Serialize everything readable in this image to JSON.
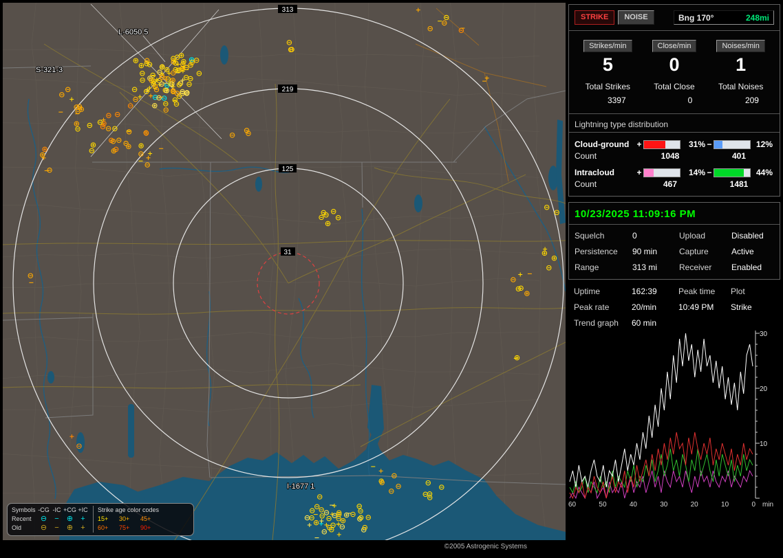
{
  "window": {
    "copyright": "©2005 Astrogenic Systems"
  },
  "map": {
    "ring_labels": [
      "313",
      "219",
      "125",
      "31"
    ],
    "storm_labels": [
      "L-6050  5",
      "S-321-3",
      "I-1677 1"
    ],
    "colors": {
      "recent_strike": "#00e0e6",
      "land": "#57504a",
      "water": "#1b5876",
      "ring": "#ececec",
      "range_ring_red": "#e04040"
    },
    "strike_clusters": [
      {
        "cx": 232,
        "cy": 118,
        "rx": 52,
        "ry": 40,
        "count": 78,
        "palette": [
          "#ffd800",
          "#ffd800",
          "#ffe34d",
          "#ffaa00"
        ],
        "cyan": 3
      },
      {
        "cx": 262,
        "cy": 86,
        "rx": 30,
        "ry": 22,
        "count": 18,
        "palette": [
          "#ffd800",
          "#ffcc00"
        ],
        "cyan": 1
      },
      {
        "cx": 158,
        "cy": 188,
        "rx": 58,
        "ry": 48,
        "count": 24,
        "palette": [
          "#ffd800",
          "#ffaa00",
          "#ff8800"
        ],
        "cyan": 0
      },
      {
        "cx": 108,
        "cy": 152,
        "rx": 38,
        "ry": 32,
        "count": 12,
        "palette": [
          "#ffaa00",
          "#ffd800"
        ],
        "cyan": 0
      },
      {
        "cx": 205,
        "cy": 225,
        "rx": 30,
        "ry": 20,
        "count": 6,
        "palette": [
          "#ffaa00",
          "#ffd800"
        ],
        "cyan": 0
      },
      {
        "cx": 60,
        "cy": 235,
        "rx": 26,
        "ry": 38,
        "count": 5,
        "palette": [
          "#ffaa00",
          "#ff8800"
        ],
        "cyan": 0
      },
      {
        "cx": 480,
        "cy": 748,
        "rx": 58,
        "ry": 34,
        "count": 42,
        "palette": [
          "#ffd800",
          "#ffe34d",
          "#ffcc00"
        ],
        "cyan": 1
      },
      {
        "cx": 560,
        "cy": 692,
        "rx": 30,
        "ry": 22,
        "count": 7,
        "palette": [
          "#ffd800",
          "#ffaa00"
        ],
        "cyan": 0
      },
      {
        "cx": 622,
        "cy": 716,
        "rx": 30,
        "ry": 25,
        "count": 5,
        "palette": [
          "#ffd800"
        ],
        "cyan": 0
      },
      {
        "cx": 470,
        "cy": 312,
        "rx": 22,
        "ry": 18,
        "count": 6,
        "palette": [
          "#ffd800"
        ],
        "cyan": 0
      },
      {
        "cx": 752,
        "cy": 402,
        "rx": 16,
        "ry": 30,
        "count": 6,
        "palette": [
          "#ffd800",
          "#ffaa00"
        ],
        "cyan": 0
      },
      {
        "cx": 796,
        "cy": 372,
        "rx": 12,
        "ry": 26,
        "count": 4,
        "palette": [
          "#ffd800"
        ],
        "cyan": 0
      },
      {
        "cx": 800,
        "cy": 300,
        "rx": 10,
        "ry": 14,
        "count": 2,
        "palette": [
          "#ffd800"
        ],
        "cyan": 0
      },
      {
        "cx": 748,
        "cy": 522,
        "rx": 10,
        "ry": 10,
        "count": 2,
        "palette": [
          "#ffd800"
        ],
        "cyan": 0
      },
      {
        "cx": 640,
        "cy": 30,
        "rx": 48,
        "ry": 22,
        "count": 7,
        "palette": [
          "#ffaa00",
          "#ff8800",
          "#ffd800"
        ],
        "cyan": 0
      },
      {
        "cx": 702,
        "cy": 116,
        "rx": 8,
        "ry": 8,
        "count": 2,
        "palette": [
          "#ffaa00"
        ],
        "cyan": 0
      },
      {
        "cx": 345,
        "cy": 185,
        "rx": 25,
        "ry": 15,
        "count": 3,
        "palette": [
          "#ffaa00"
        ],
        "cyan": 0
      },
      {
        "cx": 418,
        "cy": 62,
        "rx": 15,
        "ry": 12,
        "count": 3,
        "palette": [
          "#ffcc00"
        ],
        "cyan": 0
      },
      {
        "cx": 45,
        "cy": 420,
        "rx": 12,
        "ry": 30,
        "count": 2,
        "palette": [
          "#ffaa00"
        ],
        "cyan": 0
      },
      {
        "cx": 108,
        "cy": 640,
        "rx": 15,
        "ry": 15,
        "count": 2,
        "palette": [
          "#ff8800"
        ],
        "cyan": 0
      }
    ],
    "legend": {
      "symbols_label": "Symbols",
      "headers": [
        "-CG",
        "-IC",
        "+CG",
        "+IC"
      ],
      "recent_label": "Recent",
      "old_label": "Old",
      "glyphs": {
        "cg_minus": "⊖",
        "ic_minus": "−",
        "cg_plus": "⊕",
        "ic_plus": "+"
      },
      "age_title": "Strike age color codes",
      "age_recent": [
        "15+",
        "30+",
        "45+"
      ],
      "age_old": [
        "60+",
        "75+",
        "90+"
      ]
    }
  },
  "panel": {
    "strike_button": "STRIKE",
    "noise_button": "NOISE",
    "bearing_label": "Bng 170°",
    "bearing_value": "248mi",
    "rate_badges": [
      "Strikes/min",
      "Close/min",
      "Noises/min"
    ],
    "rates": [
      "5",
      "0",
      "1"
    ],
    "total_labels": [
      "Total Strikes",
      "Total Close",
      "Total Noises"
    ],
    "total_values": [
      "3397",
      "0",
      "209"
    ],
    "distribution": {
      "title": "Lightning type distribution",
      "count_label": "Count",
      "plus_sign": "+",
      "minus_sign": "−",
      "cloud_ground": {
        "label": "Cloud-ground",
        "plus_pct": "31%",
        "plus_pct_num": 31,
        "plus_color": "#ff1414",
        "plus_count": "1048",
        "minus_pct": "12%",
        "minus_pct_num": 12,
        "minus_color": "#5a9cf8",
        "minus_count": "401"
      },
      "intracloud": {
        "label": "Intracloud",
        "plus_pct": "14%",
        "plus_pct_num": 14,
        "plus_color": "#ff80cc",
        "plus_count": "467",
        "minus_pct": "44%",
        "minus_pct_num": 44,
        "minus_color": "#00d828",
        "minus_count": "1481"
      }
    },
    "status": {
      "datetime": "10/23/2025 11:09:16 PM",
      "squelch_label": "Squelch",
      "squelch": "0",
      "persistence_label": "Persistence",
      "persistence": "90 min",
      "range_label": "Range",
      "range": "313 mi",
      "upload_label": "Upload",
      "upload": "Disabled",
      "capture_label": "Capture",
      "capture": "Active",
      "receiver_label": "Receiver",
      "receiver": "Enabled"
    },
    "info": {
      "uptime_label": "Uptime",
      "uptime": "162:39",
      "peak_time_label": "Peak time",
      "plot_label": "Plot",
      "peak_rate_label": "Peak rate",
      "peak_rate": "20/min",
      "peak_time": "10:49 PM",
      "plot_value": "Strike",
      "trend_label": "Trend graph",
      "trend_window": "60 min"
    }
  },
  "chart_data": {
    "type": "line",
    "title": "Trend graph (strikes per minute, last 60 min)",
    "ylim": [
      0,
      30
    ],
    "y_ticks": [
      "30",
      "20",
      "10"
    ],
    "x_ticks": [
      "60",
      "50",
      "40",
      "30",
      "20",
      "10",
      "0"
    ],
    "x_unit": "min",
    "legend_position": "none",
    "grid": false,
    "series": [
      {
        "name": "series-white",
        "color": "#ffffff",
        "values": [
          3,
          5,
          2,
          6,
          3,
          4,
          2,
          5,
          7,
          4,
          3,
          6,
          2,
          5,
          4,
          7,
          3,
          6,
          9,
          5,
          8,
          6,
          10,
          7,
          12,
          9,
          15,
          11,
          17,
          13,
          20,
          16,
          23,
          18,
          26,
          21,
          29,
          24,
          30,
          25,
          28,
          22,
          27,
          23,
          29,
          24,
          26,
          21,
          25,
          20,
          24,
          18,
          22,
          17,
          21,
          16,
          23,
          19,
          26,
          28,
          24
        ]
      },
      {
        "name": "series-red",
        "color": "#e03030",
        "values": [
          1,
          0,
          2,
          1,
          3,
          0,
          2,
          1,
          4,
          2,
          1,
          3,
          0,
          2,
          4,
          1,
          3,
          2,
          5,
          1,
          4,
          2,
          6,
          3,
          5,
          7,
          4,
          8,
          5,
          9,
          6,
          10,
          7,
          11,
          8,
          12,
          9,
          10,
          6,
          11,
          8,
          12,
          9,
          7,
          10,
          8,
          11,
          6,
          9,
          7,
          10,
          8,
          6,
          9,
          5,
          8,
          6,
          10,
          7,
          9,
          8
        ]
      },
      {
        "name": "series-green",
        "color": "#30c030",
        "values": [
          2,
          1,
          3,
          1,
          2,
          4,
          1,
          3,
          2,
          1,
          4,
          2,
          3,
          1,
          5,
          2,
          4,
          3,
          2,
          5,
          3,
          6,
          2,
          4,
          3,
          6,
          4,
          7,
          3,
          5,
          8,
          4,
          6,
          9,
          5,
          7,
          4,
          8,
          6,
          3,
          7,
          5,
          9,
          4,
          6,
          8,
          5,
          3,
          7,
          4,
          8,
          6,
          4,
          7,
          3,
          6,
          4,
          8,
          5,
          7,
          6
        ]
      },
      {
        "name": "series-magenta",
        "color": "#d040c0",
        "values": [
          0,
          1,
          0,
          2,
          1,
          0,
          2,
          1,
          3,
          0,
          1,
          2,
          0,
          3,
          1,
          2,
          1,
          3,
          0,
          2,
          4,
          1,
          3,
          2,
          4,
          1,
          3,
          5,
          2,
          4,
          1,
          5,
          3,
          2,
          5,
          3,
          4,
          2,
          5,
          3,
          1,
          4,
          2,
          5,
          3,
          4,
          2,
          5,
          3,
          2,
          4,
          3,
          5,
          2,
          4,
          3,
          2,
          4,
          3,
          5,
          4
        ]
      }
    ]
  }
}
